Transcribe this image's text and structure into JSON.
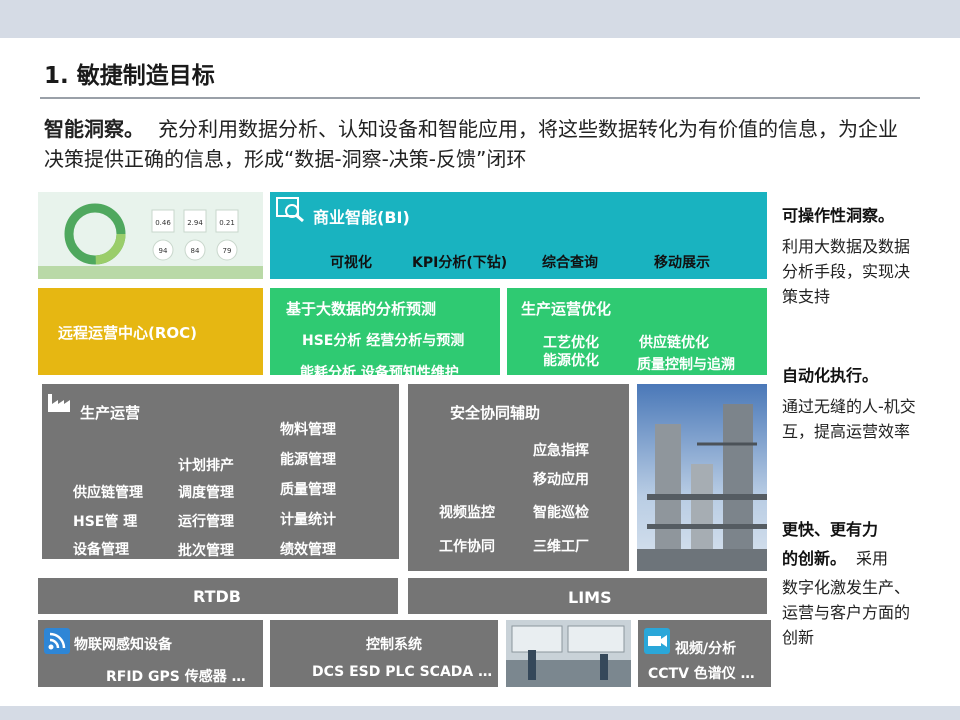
{
  "header": {
    "title": "1. 敏捷制造目标"
  },
  "intro": {
    "bold": "智能洞察。",
    "text": "充分利用数据分析、认知设备和智能应用，将这些数据转化为有价值的信息，为企业决策提供正确的信息，形成“数据-洞察-决策-反馈”闭环"
  },
  "bi": {
    "title": "商业智能(BI)",
    "items": [
      "可视化",
      "KPI分析(下钻)",
      "综合查询",
      "移动展示"
    ]
  },
  "roc": {
    "label": "远程运营中心(ROC)"
  },
  "bigdata": {
    "title": "基于大数据的分析预测",
    "line1": "HSE分析 经营分析与预测",
    "line2": "能耗分析 设备预知性维护"
  },
  "prod_opt": {
    "title": "生产运营优化",
    "a1": "工艺优化",
    "a2": "能源优化",
    "b1": "供应链优化",
    "b2": "质量控制与追溯"
  },
  "production": {
    "title": "生产运营",
    "col1": [
      "供应链管理",
      "HSE管 理",
      "设备管理"
    ],
    "col2": [
      "计划排产",
      "调度管理",
      "运行管理",
      "批次管理"
    ],
    "col3": [
      "物料管理",
      "能源管理",
      "质量管理",
      "计量统计",
      "绩效管理"
    ]
  },
  "safety": {
    "title": "安全协同辅助",
    "left": [
      "视频监控",
      "工作协同"
    ],
    "right": [
      "应急指挥",
      "移动应用",
      "智能巡检",
      "三维工厂"
    ]
  },
  "rtdb": {
    "label": "RTDB"
  },
  "lims": {
    "label": "LIMS"
  },
  "iot": {
    "title": "物联网感知设备",
    "sub": "RFID GPS 传感器 …"
  },
  "control": {
    "title": "控制系统",
    "sub": "DCS ESD PLC SCADA …"
  },
  "video": {
    "title": "视频/分析",
    "sub": "CCTV 色谱仪 …"
  },
  "dashboard": {
    "values": [
      "0.46",
      "2.94",
      "0.21",
      "94",
      "84",
      "79"
    ]
  },
  "sidebar": {
    "h1": "可操作性洞察。",
    "p1": "利用大数据及数据分析手段，实现决策支持",
    "h2": "自动化执行。",
    "p2": "通过无缝的人-机交互，提高运营效率",
    "h3a": "更快、更有力",
    "h3b": "的创新。",
    "p3a": "采用",
    "p3b": "数字化激发生产、运营与客户方面的创新"
  },
  "colors": {
    "teal": "#19b3c0",
    "green": "#2fca72",
    "yellow": "#e6b712",
    "gray": "#757575"
  }
}
